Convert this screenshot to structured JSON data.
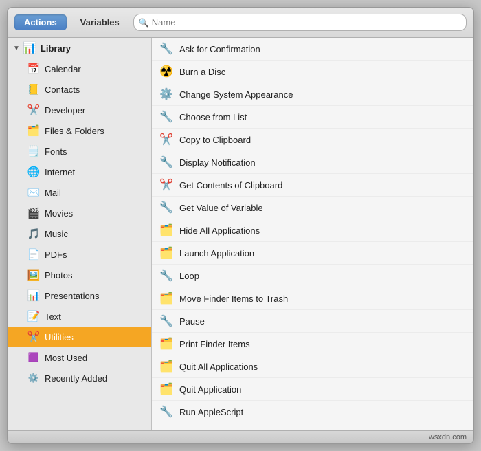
{
  "toolbar": {
    "tab_actions": "Actions",
    "tab_variables": "Variables",
    "search_placeholder": "Name"
  },
  "left_panel": {
    "library_label": "Library",
    "items": [
      {
        "id": "calendar",
        "label": "Calendar",
        "icon": "📅"
      },
      {
        "id": "contacts",
        "label": "Contacts",
        "icon": "📒"
      },
      {
        "id": "developer",
        "label": "Developer",
        "icon": "⚙️"
      },
      {
        "id": "files-folders",
        "label": "Files & Folders",
        "icon": "🗂️"
      },
      {
        "id": "fonts",
        "label": "Fonts",
        "icon": "🗒️"
      },
      {
        "id": "internet",
        "label": "Internet",
        "icon": "🌐"
      },
      {
        "id": "mail",
        "label": "Mail",
        "icon": "✉️"
      },
      {
        "id": "movies",
        "label": "Movies",
        "icon": "🎬"
      },
      {
        "id": "music",
        "label": "Music",
        "icon": "🎵"
      },
      {
        "id": "pdfs",
        "label": "PDFs",
        "icon": "📄"
      },
      {
        "id": "photos",
        "label": "Photos",
        "icon": "🖼️"
      },
      {
        "id": "presentations",
        "label": "Presentations",
        "icon": "📊"
      },
      {
        "id": "text",
        "label": "Text",
        "icon": "📝"
      },
      {
        "id": "utilities",
        "label": "Utilities",
        "icon": "🔧",
        "selected": true
      },
      {
        "id": "most-used",
        "label": "Most Used",
        "icon": "🟪"
      },
      {
        "id": "recently-added",
        "label": "Recently Added",
        "icon": "⚙️"
      }
    ]
  },
  "right_panel": {
    "items": [
      {
        "id": "ask-confirmation",
        "label": "Ask for Confirmation",
        "icon": "🔧"
      },
      {
        "id": "burn-disc",
        "label": "Burn a Disc",
        "icon": "☢️"
      },
      {
        "id": "change-appearance",
        "label": "Change System Appearance",
        "icon": "⚙️"
      },
      {
        "id": "choose-list",
        "label": "Choose from List",
        "icon": "🔧"
      },
      {
        "id": "copy-clipboard",
        "label": "Copy to Clipboard",
        "icon": "✂️"
      },
      {
        "id": "display-notification",
        "label": "Display Notification",
        "icon": "🔧"
      },
      {
        "id": "get-clipboard",
        "label": "Get Contents of Clipboard",
        "icon": "✂️"
      },
      {
        "id": "get-variable",
        "label": "Get Value of Variable",
        "icon": "🔧"
      },
      {
        "id": "hide-apps",
        "label": "Hide All Applications",
        "icon": "🗂️"
      },
      {
        "id": "launch-app",
        "label": "Launch Application",
        "icon": "🗂️"
      },
      {
        "id": "loop",
        "label": "Loop",
        "icon": "🔧"
      },
      {
        "id": "move-trash",
        "label": "Move Finder Items to Trash",
        "icon": "🗂️"
      },
      {
        "id": "pause",
        "label": "Pause",
        "icon": "🔧"
      },
      {
        "id": "print-finder",
        "label": "Print Finder Items",
        "icon": "🗂️"
      },
      {
        "id": "quit-all",
        "label": "Quit All Applications",
        "icon": "🗂️"
      },
      {
        "id": "quit-app",
        "label": "Quit Application",
        "icon": "🗂️"
      },
      {
        "id": "run-applescript",
        "label": "Run AppleScript",
        "icon": "🔧"
      }
    ]
  },
  "footer": {
    "credit": "wsxdn.com"
  }
}
